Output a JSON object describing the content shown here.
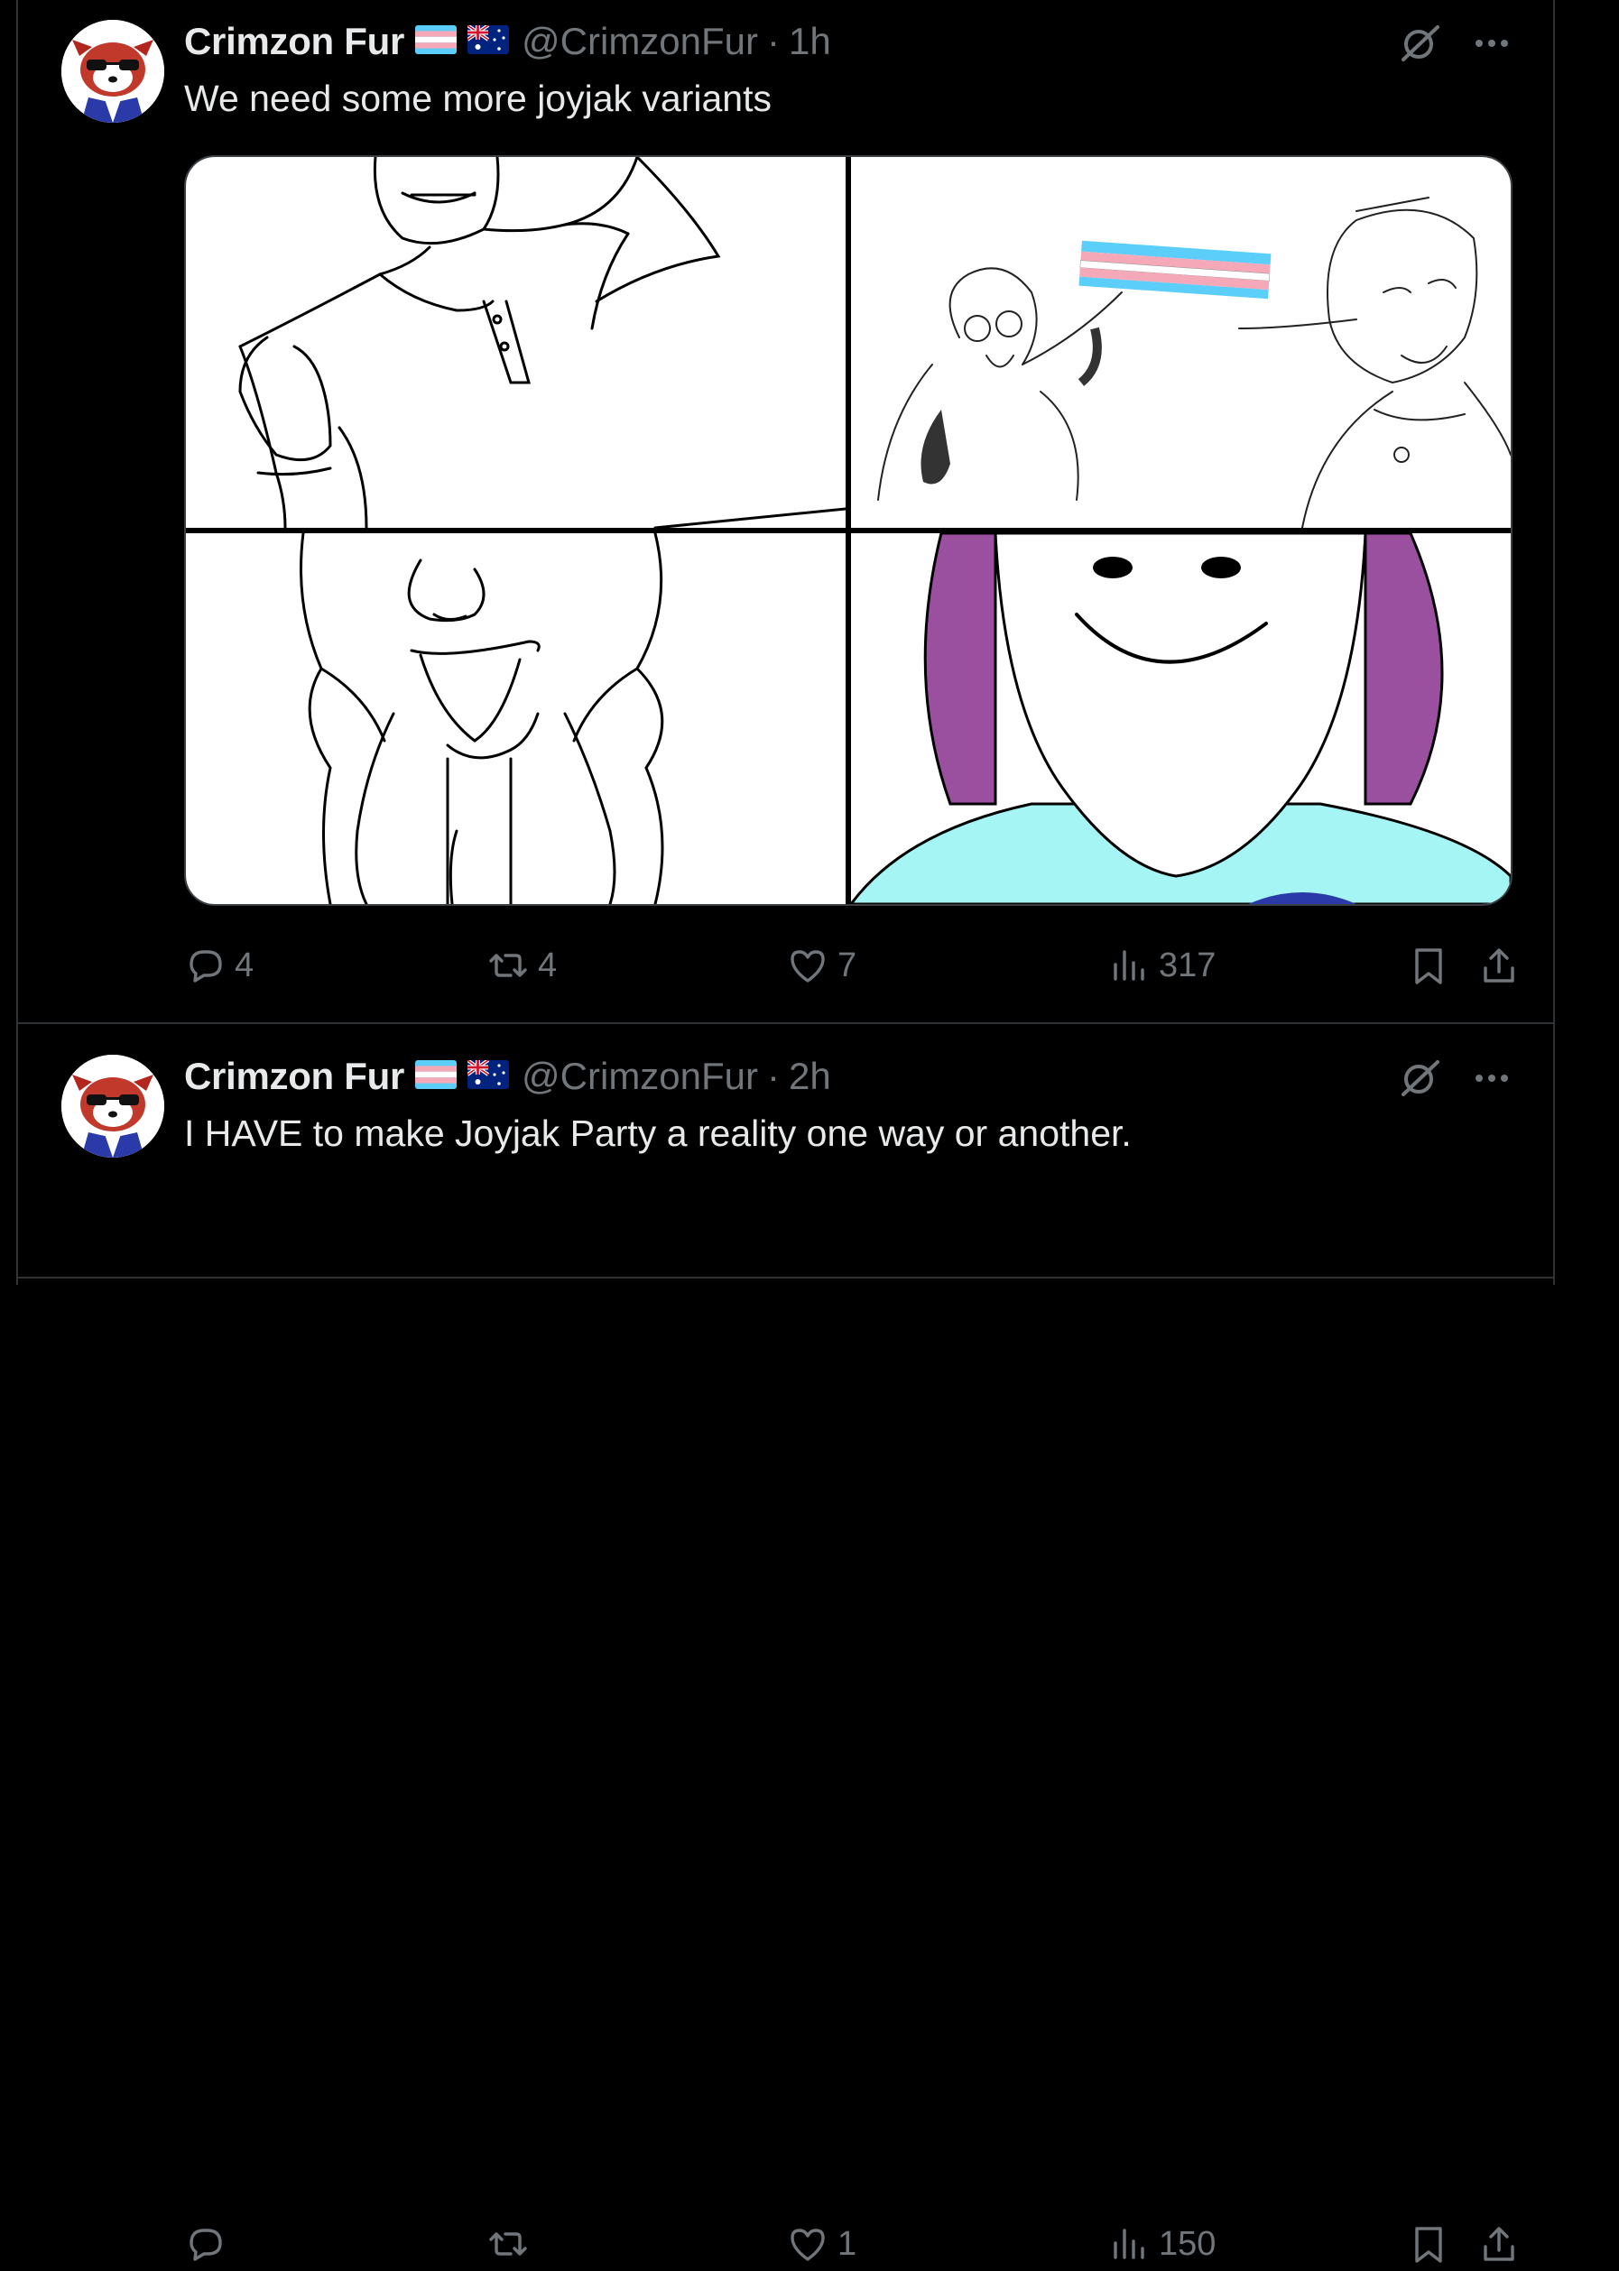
{
  "colors": {
    "background": "#000000",
    "text": "#e7e9ea",
    "muted": "#71767b",
    "divider": "#2f3336"
  },
  "tweets": [
    {
      "name": "Crimzon Fur",
      "handle": "@CrimzonFur",
      "dot": "·",
      "time": "1h",
      "text": "We need some more joyjak variants",
      "icons": [
        "trans-flag-icon",
        "australia-flag-icon",
        "grok-icon",
        "more-icon"
      ],
      "stats": {
        "replies": "4",
        "reposts": "4",
        "likes": "7",
        "views": "317"
      }
    },
    {
      "name": "Crimzon Fur",
      "handle": "@CrimzonFur",
      "dot": "·",
      "time": "2h",
      "text": "I HAVE to make Joyjak Party a reality one way or another.",
      "icons": [
        "trans-flag-icon",
        "australia-flag-icon",
        "grok-icon",
        "more-icon"
      ],
      "stats": {
        "replies": "",
        "reposts": "",
        "likes": "1",
        "views": "150"
      }
    }
  ]
}
